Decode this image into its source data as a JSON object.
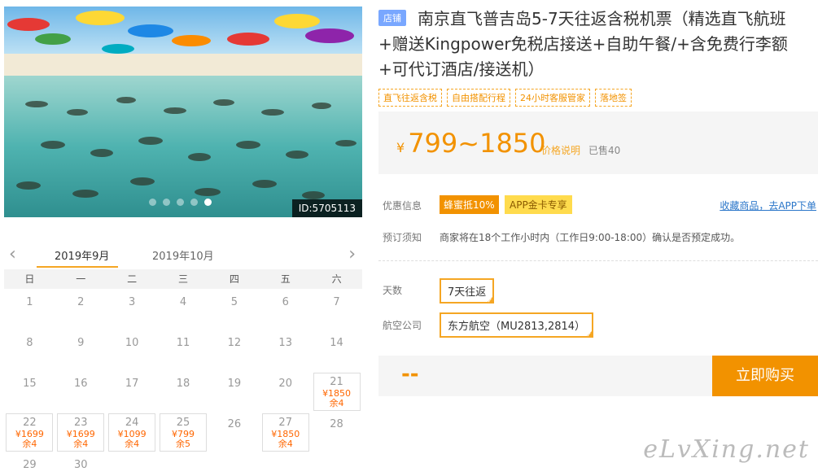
{
  "photo": {
    "id_label": "ID:5705113",
    "dot_count": 5,
    "active_dot": 4
  },
  "calendar": {
    "months": [
      "2019年9月",
      "2019年10月"
    ],
    "active_month": 0,
    "weekdays": [
      "日",
      "一",
      "二",
      "三",
      "四",
      "五",
      "六"
    ],
    "days": [
      {
        "d": "1"
      },
      {
        "d": "2"
      },
      {
        "d": "3"
      },
      {
        "d": "4"
      },
      {
        "d": "5"
      },
      {
        "d": "6"
      },
      {
        "d": "7"
      },
      {
        "d": "8"
      },
      {
        "d": "9"
      },
      {
        "d": "10"
      },
      {
        "d": "11"
      },
      {
        "d": "12"
      },
      {
        "d": "13"
      },
      {
        "d": "14"
      },
      {
        "d": "15"
      },
      {
        "d": "16"
      },
      {
        "d": "17"
      },
      {
        "d": "18"
      },
      {
        "d": "19"
      },
      {
        "d": "20"
      },
      {
        "d": "21",
        "price": "¥1850",
        "stock": "余4"
      },
      {
        "d": "22",
        "price": "¥1699",
        "stock": "余4"
      },
      {
        "d": "23",
        "price": "¥1699",
        "stock": "余4"
      },
      {
        "d": "24",
        "price": "¥1099",
        "stock": "余4"
      },
      {
        "d": "25",
        "price": "¥799",
        "stock": "余5"
      },
      {
        "d": "26"
      },
      {
        "d": "27",
        "price": "¥1850",
        "stock": "余4"
      },
      {
        "d": "28"
      },
      {
        "d": "29"
      },
      {
        "d": "30"
      }
    ]
  },
  "product": {
    "shop_tag": "店铺",
    "title": "南京直飞普吉岛5-7天往返含税机票（精选直飞航班+赠送Kingpower免税店接送+自助午餐/+含免费行李额+可代订酒店/接送机）",
    "tags": [
      "直飞往返含税",
      "自由搭配行程",
      "24小时客服管家",
      "落地签"
    ],
    "currency": "¥",
    "price_range": "799~1850",
    "price_note": "价格说明",
    "sold": "已售40"
  },
  "promo": {
    "label": "优惠信息",
    "badge1": "蜂蜜抵10%",
    "badge2": "APP金卡专享",
    "fav_link": "收藏商品，去APP下单"
  },
  "booking": {
    "label": "预订须知",
    "text": "商家将在18个工作小时内（工作日9:00-18:00）确认是否预定成功。"
  },
  "options": {
    "days_label": "天数",
    "days_value": "7天往返",
    "airline_label": "航空公司",
    "airline_value": "东方航空（MU2813,2814）"
  },
  "buy": {
    "placeholder": "--",
    "button": "立即购买"
  },
  "watermark": "eLvXing.net"
}
